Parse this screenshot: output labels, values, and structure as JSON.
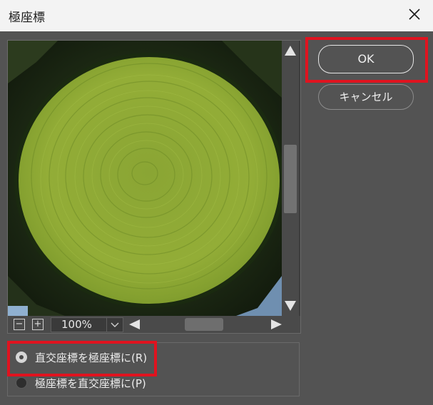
{
  "dialog": {
    "title": "極座標"
  },
  "preview": {
    "zoom_value": "100%"
  },
  "buttons": {
    "ok_label": "OK",
    "cancel_label": "キャンセル"
  },
  "options": [
    {
      "label": "直交座標を極座標に(R)",
      "selected": true
    },
    {
      "label": "極座標を直交座標に(P)",
      "selected": false
    }
  ],
  "colors": {
    "highlight": "#e0131f",
    "dialog_bg": "#535353",
    "titlebar_bg": "#f3f3f3"
  }
}
